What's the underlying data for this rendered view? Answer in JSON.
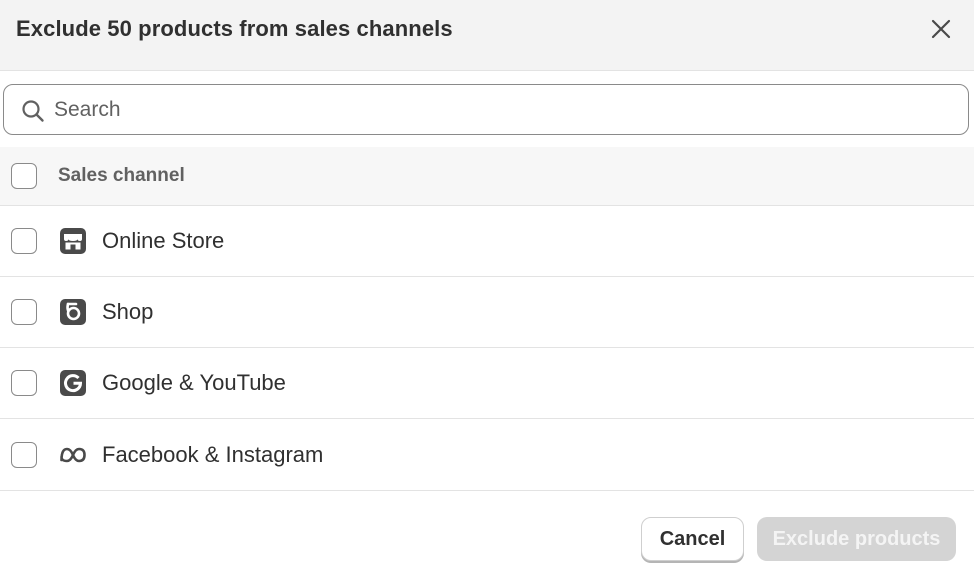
{
  "dialog": {
    "title": "Exclude 50 products from sales channels",
    "close_icon": "close-icon"
  },
  "search": {
    "placeholder": "Search",
    "value": "",
    "icon": "search-icon"
  },
  "table": {
    "header_label": "Sales channel",
    "rows": [
      {
        "label": "Online Store",
        "icon": "online-store-icon",
        "checked": false
      },
      {
        "label": "Shop",
        "icon": "shop-icon",
        "checked": false
      },
      {
        "label": "Google & YouTube",
        "icon": "google-icon",
        "checked": false
      },
      {
        "label": "Facebook & Instagram",
        "icon": "meta-icon",
        "checked": false
      }
    ]
  },
  "footer": {
    "cancel_label": "Cancel",
    "exclude_label": "Exclude products"
  },
  "colors": {
    "icon": "#4a4a4a",
    "disabled_button": "#d4d4d4",
    "border": "#e3e3e3"
  }
}
